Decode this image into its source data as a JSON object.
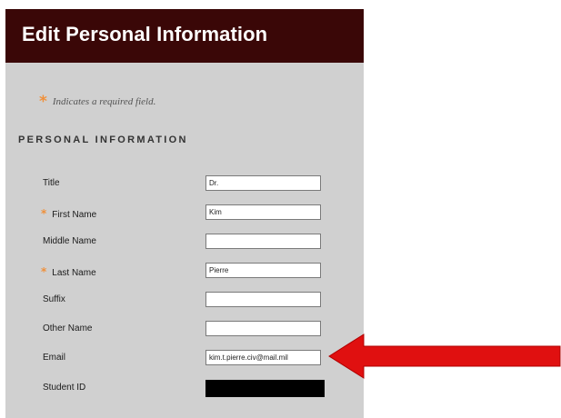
{
  "header": {
    "title": "Edit Personal Information"
  },
  "required_note": {
    "marker": "*",
    "text": "Indicates a required field."
  },
  "section": {
    "title": "PERSONAL INFORMATION"
  },
  "fields": [
    {
      "label": "Title",
      "value": "Dr.",
      "required": false
    },
    {
      "label": "First Name",
      "value": "Kim",
      "required": true
    },
    {
      "label": "Middle Name",
      "value": "",
      "required": false
    },
    {
      "label": "Last Name",
      "value": "Pierre",
      "required": true
    },
    {
      "label": "Suffix",
      "value": "",
      "required": false
    },
    {
      "label": "Other Name",
      "value": "",
      "required": false
    },
    {
      "label": "Email",
      "value": "kim.t.pierre.civ@mail.mil",
      "required": false
    },
    {
      "label": "Student ID",
      "value": "",
      "required": false,
      "redacted": true
    }
  ],
  "colors": {
    "header_bg": "#3a0707",
    "panel_bg": "#d0d0d0",
    "required_marker": "#f0903a",
    "arrow": "#e01010"
  },
  "icons": {
    "callout": "red-arrow-pointing-left"
  }
}
